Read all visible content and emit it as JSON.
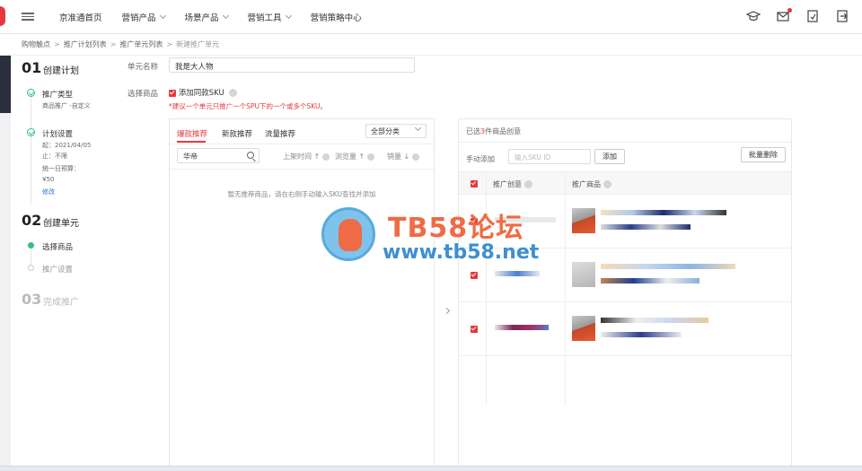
{
  "colors": {
    "accent": "#e4393c",
    "success": "#2ec27e",
    "link": "#2f6fd6"
  },
  "nav": {
    "items": [
      {
        "label": "京准通首页",
        "dropdown": false
      },
      {
        "label": "营销产品",
        "dropdown": true
      },
      {
        "label": "场景产品",
        "dropdown": true
      },
      {
        "label": "营销工具",
        "dropdown": true
      },
      {
        "label": "营销策略中心",
        "dropdown": false
      }
    ],
    "icons": [
      "graduation-cap-icon",
      "mail-icon",
      "document-icon",
      "exit-icon"
    ]
  },
  "breadcrumb": [
    "购物触点",
    "推广计划列表",
    "推广单元列表",
    "新建推广单元"
  ],
  "steps": {
    "s1": {
      "num": "01",
      "title": "创建计划"
    },
    "type": {
      "label": "推广类型",
      "value": "商品推广 -自定义"
    },
    "settings": {
      "label": "计划设置",
      "start": "起：2021/04/05",
      "end": "止：不限",
      "budget_label": "统一日预算：",
      "budget": "¥50",
      "edit": "修改"
    },
    "s2": {
      "num": "02",
      "title": "创建单元"
    },
    "select_goods": "选择商品",
    "promo_settings": "推广设置",
    "s3": {
      "num": "03",
      "title": "完成推广"
    }
  },
  "form": {
    "unit_name_label": "单元名称",
    "unit_name_value": "我是大人物",
    "select_goods_label": "选择商品",
    "same_sku_label": "添加同款SKU",
    "hint": "*建议一个单元只推广一个SPU下的一个或多个SKU。"
  },
  "left_panel": {
    "tabs": [
      "爆款推荐",
      "新款推荐",
      "流量推荐"
    ],
    "category_select": "全部分类",
    "search_value": "华帝",
    "sort": {
      "shelf_time": "上架时间 ↑",
      "views": "浏览量 ↑",
      "sales": "销量 ↓"
    },
    "empty_msg": "暂无推荐商品，请在右侧手动输入SKU查找并添加"
  },
  "right_panel": {
    "count_prefix": "已选",
    "count": "3",
    "count_suffix": "件商品创意",
    "manual_add_label": "手动添加",
    "sku_placeholder": "输入SKU ID",
    "add_button": "添加",
    "batch_delete": "批量删除",
    "col_creative": "推广创意",
    "col_goods": "推广商品"
  },
  "watermark": {
    "line1": "TB58论坛",
    "line2": "www.tb58.net"
  }
}
